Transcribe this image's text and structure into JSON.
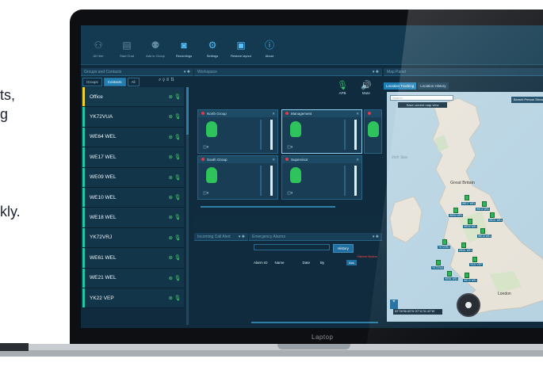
{
  "background_text": [
    "ts,",
    "g",
    "kly."
  ],
  "toolbar": {
    "buttons": [
      {
        "label": "All Hire",
        "icon": "group-icon"
      },
      {
        "label": "Start Chat",
        "icon": "chat-icon"
      },
      {
        "label": "Add to Group",
        "icon": "add-group-icon"
      },
      {
        "label": "Recordings",
        "icon": "recordings-icon"
      },
      {
        "label": "Settings",
        "icon": "gear-icon"
      },
      {
        "label": "Restore layout",
        "icon": "layout-icon"
      },
      {
        "label": "About",
        "icon": "info-icon"
      }
    ]
  },
  "groups_contacts": {
    "title": "Groups and Contacts",
    "tabs": [
      "Groups",
      "Contacts",
      "All"
    ],
    "active_tab": "Contacts",
    "items": [
      "Office",
      "YK72VUA",
      "WE64 WEL",
      "WE17 WEL",
      "WE09 WEL",
      "WE10 WEL",
      "WE18 WEL",
      "YK72VRJ",
      "WE61 WEL",
      "WE21 WEL",
      "YK22 VEP"
    ]
  },
  "workspace": {
    "title": "Workspace",
    "apb_label": "APB",
    "mute_label": "Mute",
    "tiles": [
      {
        "name": "North Group",
        "selected": false
      },
      {
        "name": "Management",
        "selected": true
      },
      {
        "name": "South Group",
        "selected": false
      },
      {
        "name": "Supervisor",
        "selected": false
      }
    ]
  },
  "incoming_calls": {
    "title": "Incoming Call Alert"
  },
  "emergency_alarms": {
    "title": "Emergency Alarms",
    "history_button": "History",
    "silence_label": "Silence Button",
    "columns": [
      "Alarm ID",
      "Name",
      "Date",
      "By"
    ],
    "ack_button": "Ack"
  },
  "map_panel": {
    "title": "Map Panel",
    "tabs": [
      "Location Tracking",
      "Location History"
    ],
    "active_tab": "Location Tracking",
    "search_placeholder": "Search",
    "save_view_label": "Save current map view",
    "right_button": "Search Person Show Person",
    "sea_label": "Irish Sea",
    "country_label": "Great Britain",
    "city_label": "London",
    "status_text": "52°26'56.80\"N 00°11'31.42\"W",
    "markers": [
      {
        "label": "WE17 WEL"
      },
      {
        "label": "WE10 WEL"
      },
      {
        "label": "WE64 WEL"
      },
      {
        "label": "WE21 WEL"
      },
      {
        "label": "WE09 WEL"
      },
      {
        "label": "WE18 WEL"
      },
      {
        "label": "YK72VRJ"
      },
      {
        "label": "WE61 WEL"
      },
      {
        "label": "YK72VUA"
      },
      {
        "label": "YK22 VEP"
      },
      {
        "label": "WE61 WEL"
      },
      {
        "label": "WE10 WEL"
      }
    ]
  },
  "laptop": {
    "label": "Laptop"
  }
}
